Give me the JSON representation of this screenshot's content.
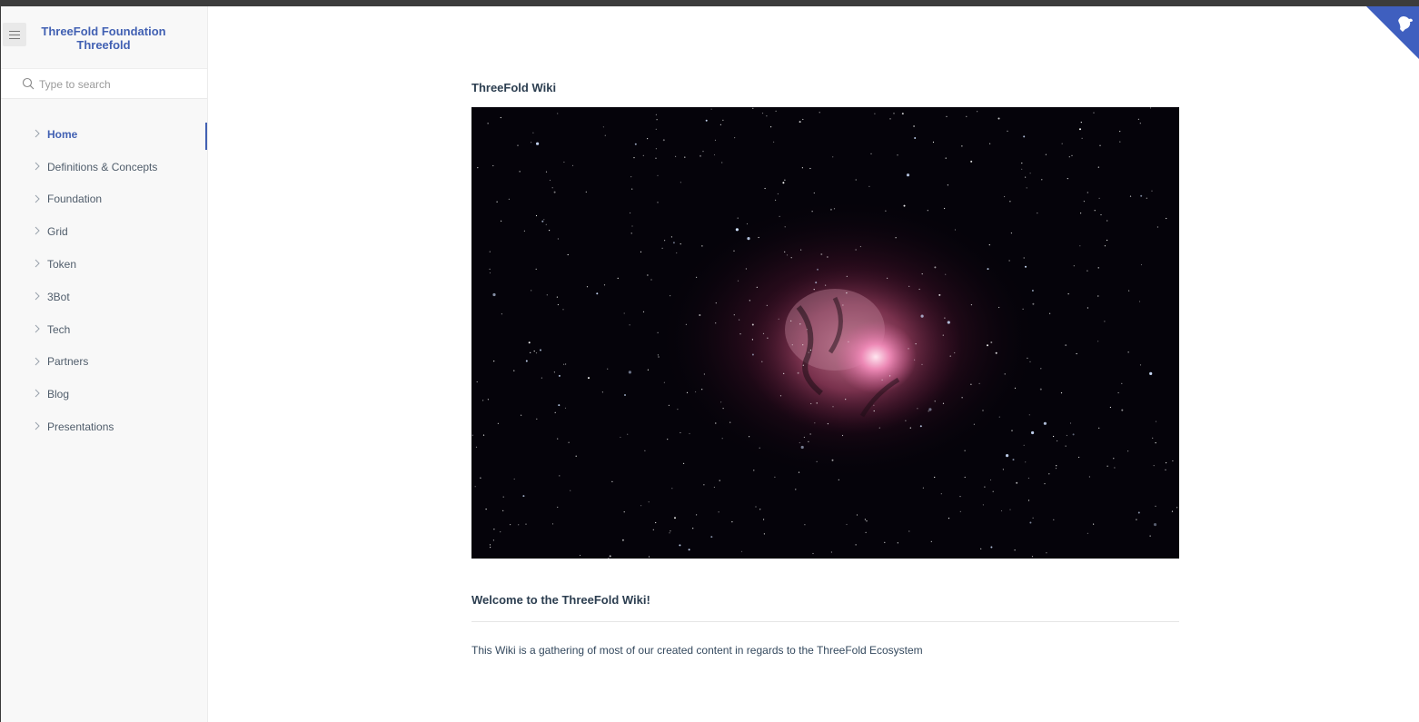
{
  "sidebar": {
    "app_name_line1": "ThreeFold Foundation",
    "app_name_line2": "Threefold",
    "search_placeholder": "Type to search",
    "items": [
      {
        "label": "Home",
        "active": true
      },
      {
        "label": "Definitions & Concepts",
        "active": false
      },
      {
        "label": "Foundation",
        "active": false
      },
      {
        "label": "Grid",
        "active": false
      },
      {
        "label": "Token",
        "active": false
      },
      {
        "label": "3Bot",
        "active": false
      },
      {
        "label": "Tech",
        "active": false
      },
      {
        "label": "Partners",
        "active": false
      },
      {
        "label": "Blog",
        "active": false
      },
      {
        "label": "Presentations",
        "active": false
      }
    ]
  },
  "main": {
    "page_title": "ThreeFold Wiki",
    "welcome_heading": "Welcome to the ThreeFold Wiki!",
    "intro_text": "This Wiki is a gathering of most of our created content in regards to the ThreeFold Ecosystem"
  },
  "icons": {
    "menu": "hamburger-icon",
    "search": "search-icon",
    "chevron": "chevron-right-icon",
    "corner": "github-corner-icon"
  },
  "colors": {
    "accent": "#4261b3",
    "text": "#34495e",
    "sidebar_bg": "#f8f8f8",
    "corner": "#3f5fbf"
  }
}
